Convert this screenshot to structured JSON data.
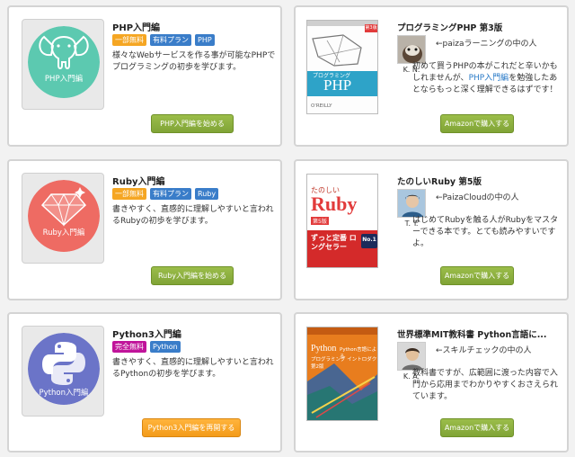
{
  "courses": [
    {
      "icon_caption": "PHP入門編",
      "icon": "elephant-icon",
      "title": "PHP入門編",
      "tags": [
        "一部無料",
        "有料プラン",
        "PHP"
      ],
      "description": "様々なWebサービスを作る事が可能なPHPでプログラミングの初歩を学びます。",
      "button": "PHP入門編を始める"
    },
    {
      "icon_caption": "Ruby入門編",
      "icon": "gem-icon",
      "title": "Ruby入門編",
      "tags": [
        "一部無料",
        "有料プラン",
        "Ruby"
      ],
      "description": "書きやすく、直感的に理解しやすいと言われるRubyの初歩を学びます。",
      "button": "Ruby入門編を始める"
    },
    {
      "icon_caption": "Python入門編",
      "icon": "python-logo-icon",
      "title": "Python3入門編",
      "tags": [
        "完全無料",
        "Python"
      ],
      "description": "書きやすく、直感的に理解しやすいと言われるPythonの初歩を学びます。",
      "button": "Python3入門編を再開する"
    }
  ],
  "books": [
    {
      "title": "プログラミングPHP 第3版",
      "reviewer": "K. N.",
      "recommender": "←paizaラーニングの中の人",
      "review_before": "初めて買うPHPの本がこれだと辛いかもしれませんが、",
      "review_link": "PHP入門編",
      "review_after": "を勉強したあとならもっと深く理解できるはずです！",
      "button": "Amazonで購入する",
      "cover": {
        "series_text": "プログラミング",
        "title_text": "PHP",
        "badge": "第3版",
        "publisher": "O'REILLY"
      }
    },
    {
      "title": "たのしいRuby 第5版",
      "reviewer": "T. Y.",
      "recommender": "←PaizaCloudの中の人",
      "review_before": "はじめてRubyを触る人がRubyをマスターできる本です。とても読みやすいですよ。",
      "review_link": "",
      "review_after": "",
      "button": "Amazonで購入する",
      "cover": {
        "series_text": "たのしい",
        "title_text": "Ruby",
        "badge": "第5版",
        "banner": "ずっと定番 ロングセラー",
        "no1": "No.1"
      }
    },
    {
      "title": "世界標準MIT教科書 Python言語に...",
      "reviewer": "K. A.",
      "recommender": "←スキルチェックの中の人",
      "review_before": "教科書ですが、広範囲に渡った内容で入門から応用までわかりやすくおさえられています。",
      "review_link": "",
      "review_after": "",
      "button": "Amazonで購入する",
      "cover": {
        "series_text": "Python言語による",
        "title_text": "Python",
        "subtitle": "プログラミング イントロダクション",
        "badge": "第2版"
      }
    }
  ],
  "colors": {
    "php_icon_bg": "#5cc9b0",
    "ruby_icon_bg": "#ee6b63",
    "python_icon_bg": "#6b74c8",
    "button_green": "#8cb03f",
    "button_orange": "#f5a623",
    "link_blue": "#2b7bc8"
  }
}
